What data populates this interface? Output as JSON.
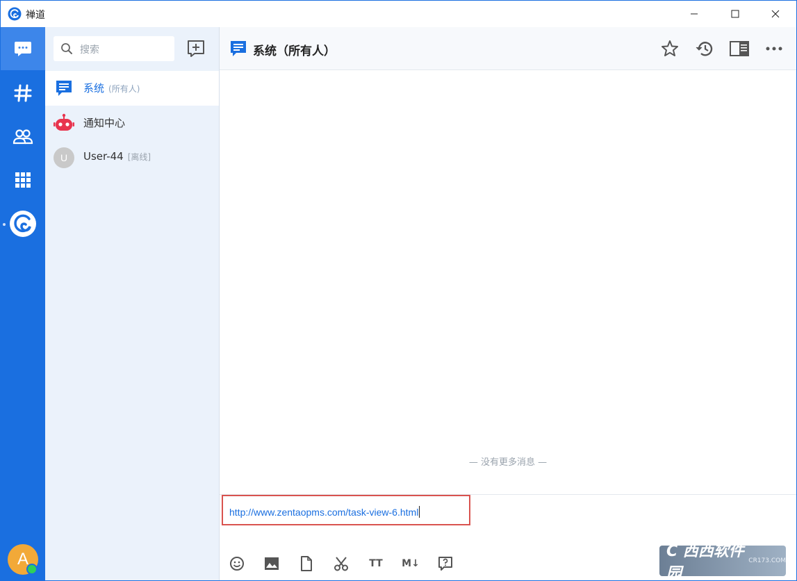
{
  "window": {
    "title": "禅道"
  },
  "nav": {
    "items": [
      {
        "name": "chats",
        "icon": "chat-bubble-icon",
        "active": true
      },
      {
        "name": "channels",
        "icon": "hashtag-icon"
      },
      {
        "name": "contacts",
        "icon": "users-icon"
      },
      {
        "name": "apps",
        "icon": "grid-icon"
      },
      {
        "name": "zentao",
        "icon": "zentao-logo-icon"
      }
    ],
    "user_avatar_letter": "A",
    "user_status": "online"
  },
  "search": {
    "placeholder": "搜索"
  },
  "chat_list": [
    {
      "name": "系统",
      "sub": "(所有人)",
      "icon": "system-chat-icon",
      "active": true
    },
    {
      "name": "通知中心",
      "icon": "robot-icon"
    },
    {
      "name": "User-44",
      "status": "[离线]",
      "avatar_letter": "U"
    }
  ],
  "chat": {
    "title": "系统（所有人）",
    "no_more_messages": "— 没有更多消息 —",
    "input_value": "http://www.zentaopms.com/task-view-6.html"
  },
  "header_actions": [
    "star-icon",
    "history-icon",
    "sidebar-toggle-icon",
    "more-icon"
  ],
  "toolbar": {
    "font_label": "TT",
    "markdown_label": "M↓"
  },
  "watermark": {
    "main": "C 西西软件园",
    "sub": "CR173.COM"
  },
  "colors": {
    "brand": "#1a6fe0",
    "highlight_border": "#d9534f",
    "robot": "#e8344e",
    "online": "#2fcf5a"
  }
}
